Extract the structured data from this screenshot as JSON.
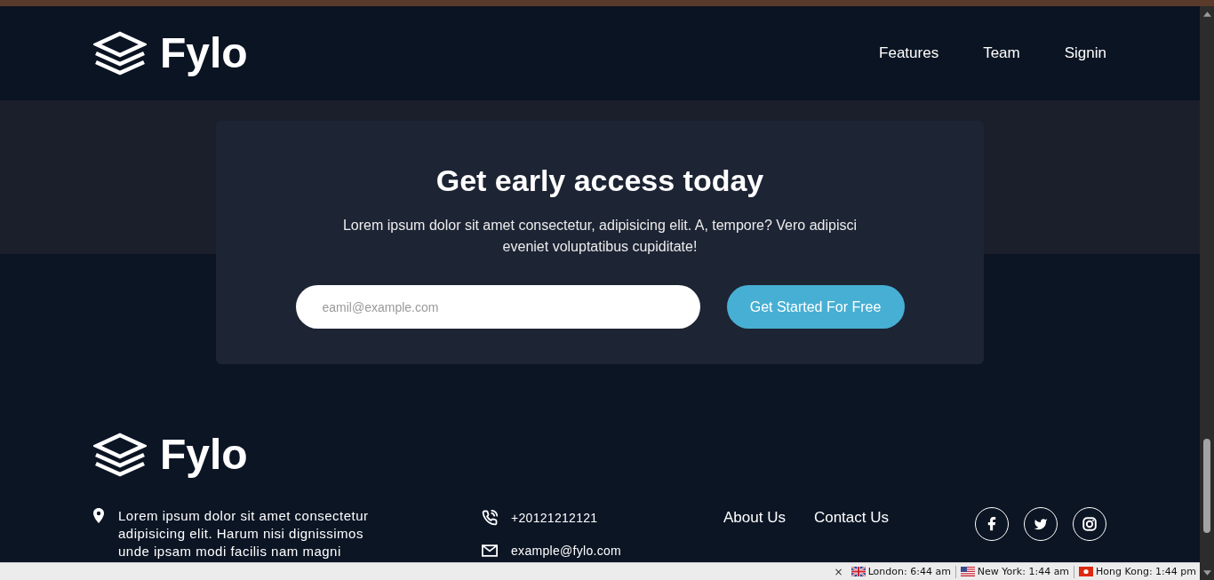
{
  "header": {
    "logo": "Fylo",
    "nav": [
      "Features",
      "Team",
      "Signin"
    ]
  },
  "signup": {
    "title": "Get early access today",
    "text": "Lorem ipsum dolor sit amet consectetur, adipisicing elit. A, tempore? Vero adipisci eveniet voluptatibus cupiditate!",
    "email": {
      "placeholder": "eamil@example.com"
    },
    "button": "Get Started For Free"
  },
  "footer": {
    "logo": "Fylo",
    "address": "Lorem ipsum dolor sit amet consectetur adipisicing elit. Harum nisi dignissimos unde ipsam modi facilis nam magni",
    "phone": "+20121212121",
    "email": "example@fylo.com",
    "links": [
      "About Us",
      "Contact Us"
    ]
  },
  "status_bar": {
    "close": "×",
    "clocks": [
      "London: 6:44 am",
      "New York: 1:44 am",
      "Hong Kong: 1:44 pm"
    ]
  }
}
